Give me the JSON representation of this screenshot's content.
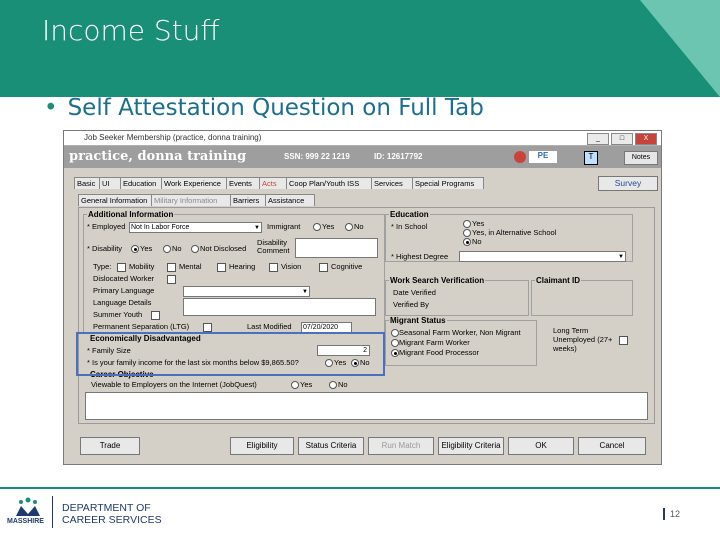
{
  "slide": {
    "title": "Income Stuff",
    "bullet": "Self Attestation Question on Full Tab",
    "colors": {
      "accent": "#1a8f78",
      "brand_navy": "#1f3b6e",
      "highlight_box": "#4a70c0"
    }
  },
  "window": {
    "title": "Job Seeker Membership (practice, donna training)",
    "controls": [
      "_",
      "□",
      "X"
    ]
  },
  "userbar": {
    "name": "practice, donna training",
    "ssn_label": "SSN: 999 22 1219",
    "id_label": "ID: 12617792",
    "pe": "PE",
    "t": "T",
    "notes": "Notes"
  },
  "tabs": [
    "Basic",
    "UI",
    "Education",
    "Work Experience",
    "Events",
    "Acts",
    "Coop Plan/Youth ISS",
    "Services",
    "Special Programs"
  ],
  "survey": "Survey",
  "subtabs": [
    "General Information",
    "Military Information",
    "Barriers",
    "Assistance"
  ],
  "additional_info": {
    "title": "Additional Information",
    "employed_label": "Employed",
    "employed_value": "Not In Labor Force",
    "immigrant_label": "Immigrant",
    "yes": "Yes",
    "no": "No",
    "disability_label": "Disability",
    "not_disclosed": "Not Disclosed",
    "disability_comment": "Disability Comment",
    "type_label": "Type:",
    "mobility": "Mobility",
    "mental": "Mental",
    "hearing": "Hearing",
    "vision": "Vision",
    "cognitive": "Cognitive",
    "dislocated_worker": "Dislocated Worker",
    "primary_language": "Primary Language",
    "language_details": "Language Details",
    "summer_youth": "Summer Youth",
    "permanent_separation": "Permanent Separation (LTG)",
    "last_modified_label": "Last Modified",
    "last_modified_value": "07/20/2020"
  },
  "econ": {
    "title": "Economically Disadvantaged",
    "family_size_label": "Family Size",
    "family_size_value": "2",
    "income_question": "Is your family income for the last six months below $9,865.50?",
    "yes": "Yes",
    "no": "No"
  },
  "career": {
    "title": "Career Objective",
    "viewable_label": "Viewable to Employers on the Internet (JobQuest)",
    "yes": "Yes",
    "no": "No"
  },
  "education": {
    "title": "Education",
    "in_school_label": "In School",
    "options": [
      "Yes",
      "Yes, in Alternative School",
      "No"
    ],
    "selected": "No",
    "highest_degree_label": "Highest Degree"
  },
  "work_search": {
    "title": "Work Search Verification",
    "date_verified": "Date Verified",
    "verified_by": "Verified By"
  },
  "claimant": {
    "title": "Claimant ID"
  },
  "migrant": {
    "title": "Migrant Status",
    "options": [
      "Seasonal Farm Worker, Non Migrant",
      "Migrant Farm Worker",
      "Migrant Food Processor"
    ],
    "selected": "Migrant Food Processor",
    "long_term_label": "Long Term Unemployed (27+ weeks)"
  },
  "buttons": {
    "trade": "Trade",
    "eligibility": "Eligibility",
    "status_criteria": "Status Criteria",
    "run_match": "Run Match",
    "eligibility_criteria": "Eligibility Criteria",
    "ok": "OK",
    "cancel": "Cancel"
  },
  "footer": {
    "logo_text": "MASSHIRE",
    "dept_line1": "DEPARTMENT OF",
    "dept_line2": "CAREER SERVICES",
    "page_number": "12"
  }
}
